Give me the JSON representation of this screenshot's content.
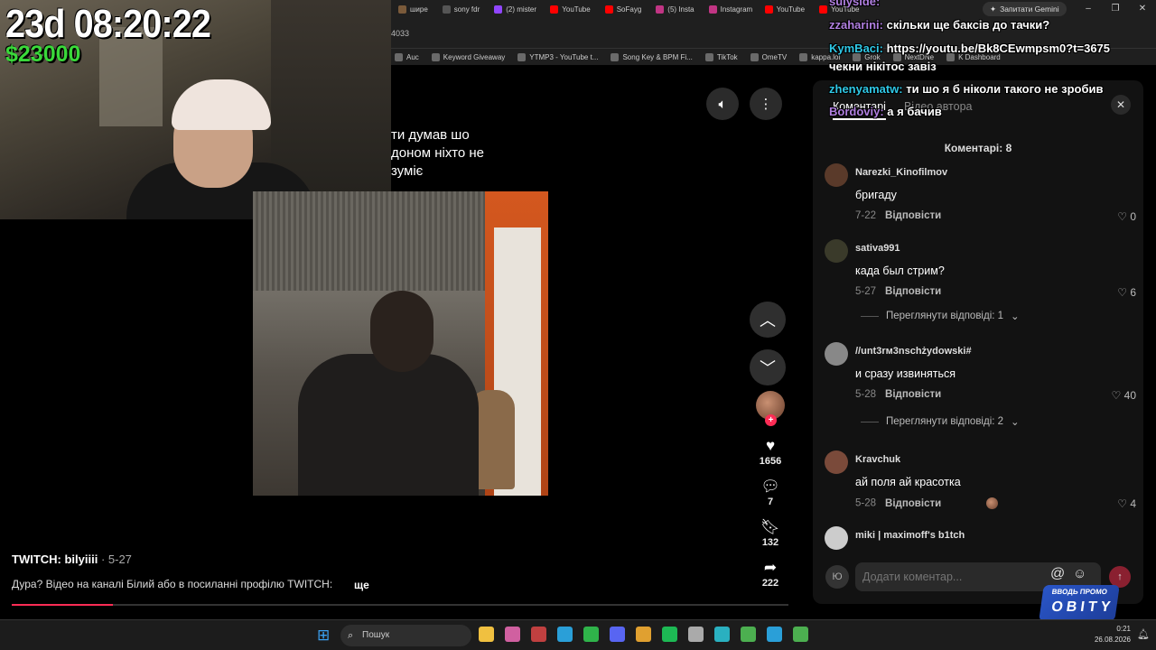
{
  "stream_overlay": {
    "timer": "23d 08:20:22",
    "money": "$23000"
  },
  "browser": {
    "tabs": [
      {
        "label": "шире",
        "color": "#7a5a3a"
      },
      {
        "label": "sony fdr",
        "color": "#555555"
      },
      {
        "label": "(2) mister",
        "color": "#9146ff"
      },
      {
        "label": "YouTube",
        "color": "#ff0000"
      },
      {
        "label": "SoFayg",
        "color": "#ff0000"
      },
      {
        "label": "(5) Insta",
        "color": "#c13584"
      },
      {
        "label": "Instagram",
        "color": "#c13584"
      },
      {
        "label": "YouTube",
        "color": "#ff0000"
      },
      {
        "label": "YouTube",
        "color": "#ff0000"
      }
    ],
    "url_fragment": "4033",
    "gemini_label": "Запитати Gemini",
    "bookmarks": [
      "Auc",
      "Keyword Giveaway",
      "YTMP3 - YouTube t...",
      "Song Key & BPM Fi...",
      "TikTok",
      "OmeTV",
      "kappa.lol",
      "Grok",
      "NextDNe",
      "K Dashboard"
    ]
  },
  "chat": {
    "messages": [
      {
        "user": "suiyside:",
        "text": "",
        "user_color": "#b07fe0"
      },
      {
        "user": "zzaharini:",
        "text": "скільки ще баксів до тачки?",
        "user_color": "#b07fe0"
      },
      {
        "user": "KymBaci:",
        "text": "https://youtu.be/Bk8CEwmpsm0?t=3675",
        "user_color": "#2fc8e6"
      },
      {
        "user": "",
        "text": "чекни нікітос завіз",
        "user_color": "#ffffff"
      },
      {
        "user": "zhenyamatw:",
        "text": "ти шо я б ніколи такого не зробив",
        "user_color": "#2fc8e6"
      },
      {
        "user": "Bordoviy:",
        "text": "а я бачив",
        "user_color": "#b07fe0"
      }
    ]
  },
  "video": {
    "caption": "ти думав шо\nдоном ніхто не\nзуміє",
    "author": "TWITCH: bilyiiii",
    "date": "· 5-27",
    "description": "Дура? Відео на каналі Білий або в посиланні профілю TWITCH:",
    "more_label": "ще",
    "likes": "1656",
    "comments": "7",
    "saves": "132",
    "shares": "222",
    "progress_fraction": 0.13
  },
  "comments_panel": {
    "tabs": [
      "Коментарі",
      "Відео автора"
    ],
    "count_label": "Коментарі: 8",
    "reply_label": "Відповісти",
    "comments": [
      {
        "name": "Narezki_Kinofilmov",
        "text": "бригаду",
        "date": "7-22",
        "likes": "0",
        "avatar_color": "#5a3a2a"
      },
      {
        "name": "sativa991",
        "text": "када был стрим?",
        "date": "5-27",
        "likes": "6",
        "avatar_color": "#3a3a2a"
      },
      {
        "name": "//unt3rм3nschżydowski#",
        "text": "и сразу извиняться",
        "date": "5-28",
        "likes": "40",
        "avatar_color": "#888888"
      },
      {
        "name": "Kravchuk",
        "text": "ай поля ай красотка",
        "date": "5-28",
        "likes": "4",
        "avatar_color": "#7a4a3a"
      },
      {
        "name": "miki | maximoff's b1tch",
        "text": "",
        "date": "",
        "likes": "",
        "avatar_color": "#cccccc"
      }
    ],
    "view_replies": [
      "Переглянути відповіді: 1",
      "Переглянути відповіді: 2"
    ],
    "input_avatar": "Ю",
    "input_placeholder": "Додати коментар..."
  },
  "badge": {
    "line1": "ВВОДЬ ПРОМО",
    "line2": "OBITY"
  },
  "taskbar": {
    "search_label": "Пошук",
    "time": "0:21",
    "date": "26.08.2026",
    "icon_colors": [
      "#f0c040",
      "#d060a0",
      "#c04040",
      "#2a9fd8",
      "#2fb34a",
      "#5865f2",
      "#e0a030",
      "#1db954",
      "#aaaaaa",
      "#2ab0c0",
      "#4caf50",
      "#2a9fd8",
      "#4caf50"
    ]
  }
}
